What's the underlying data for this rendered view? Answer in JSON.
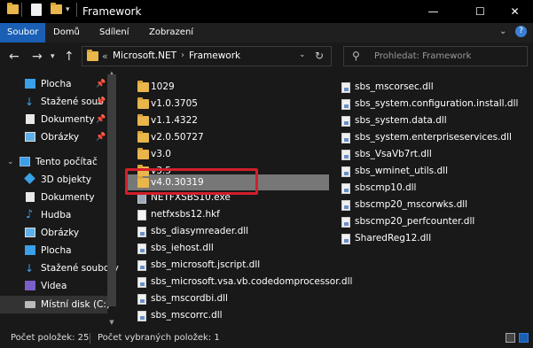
{
  "window": {
    "title": "Framework",
    "controls": {
      "minimize": "—",
      "maximize": "☐",
      "close": "✕"
    }
  },
  "ribbon": {
    "tabs": [
      "Soubor",
      "Domů",
      "Sdílení",
      "Zobrazení"
    ],
    "active_tab_color": "#1a5fb4"
  },
  "nav": {
    "path": [
      "Microsoft.NET",
      "Framework"
    ],
    "overflow": "«",
    "search_placeholder": "Prohledat: Framework"
  },
  "sidebar": {
    "items": [
      {
        "label": "Plocha",
        "icon": "desktop-icon",
        "pinned": true
      },
      {
        "label": "Stažené soub",
        "icon": "download-icon",
        "pinned": true
      },
      {
        "label": "Dokumenty",
        "icon": "documents-icon",
        "pinned": true
      },
      {
        "label": "Obrázky",
        "icon": "pictures-icon",
        "pinned": true
      },
      {
        "label": "Tento počítač",
        "icon": "computer-icon",
        "pinned": false
      },
      {
        "label": "3D objekty",
        "icon": "3d-objects-icon",
        "pinned": false
      },
      {
        "label": "Dokumenty",
        "icon": "documents-icon",
        "pinned": false
      },
      {
        "label": "Hudba",
        "icon": "music-icon",
        "pinned": false
      },
      {
        "label": "Obrázky",
        "icon": "pictures-icon",
        "pinned": false
      },
      {
        "label": "Plocha",
        "icon": "desktop-icon",
        "pinned": false
      },
      {
        "label": "Stažené soubory",
        "icon": "download-icon",
        "pinned": false
      },
      {
        "label": "Videa",
        "icon": "video-icon",
        "pinned": false
      },
      {
        "label": "Místní disk (C:)",
        "icon": "drive-icon",
        "pinned": false
      }
    ]
  },
  "files": {
    "col1": [
      {
        "name": "1029",
        "type": "folder"
      },
      {
        "name": "v1.0.3705",
        "type": "folder"
      },
      {
        "name": "v1.1.4322",
        "type": "folder"
      },
      {
        "name": "v2.0.50727",
        "type": "folder"
      },
      {
        "name": "v3.0",
        "type": "folder"
      },
      {
        "name": "v3.5",
        "type": "folder"
      },
      {
        "name": "v4.0.30319",
        "type": "folder",
        "selected": true
      },
      {
        "name": "NETFXSBS10.exe",
        "type": "exe"
      },
      {
        "name": "netfxsbs12.hkf",
        "type": "file"
      },
      {
        "name": "sbs_diasymreader.dll",
        "type": "dll"
      },
      {
        "name": "sbs_iehost.dll",
        "type": "dll"
      },
      {
        "name": "sbs_microsoft.jscript.dll",
        "type": "dll"
      },
      {
        "name": "sbs_microsoft.vsa.vb.codedomprocessor.dll",
        "type": "dll"
      },
      {
        "name": "sbs_mscordbi.dll",
        "type": "dll"
      },
      {
        "name": "sbs_mscorrc.dll",
        "type": "dll"
      }
    ],
    "col2": [
      {
        "name": "sbs_mscorsec.dll",
        "type": "dll"
      },
      {
        "name": "sbs_system.configuration.install.dll",
        "type": "dll"
      },
      {
        "name": "sbs_system.data.dll",
        "type": "dll"
      },
      {
        "name": "sbs_system.enterpriseservices.dll",
        "type": "dll"
      },
      {
        "name": "sbs_VsaVb7rt.dll",
        "type": "dll"
      },
      {
        "name": "sbs_wminet_utils.dll",
        "type": "dll"
      },
      {
        "name": "sbscmp10.dll",
        "type": "dll"
      },
      {
        "name": "sbscmp20_mscorwks.dll",
        "type": "dll"
      },
      {
        "name": "sbscmp20_perfcounter.dll",
        "type": "dll"
      },
      {
        "name": "SharedReg12.dll",
        "type": "dll"
      }
    ]
  },
  "status": {
    "count": "Počet položek: 25",
    "selected": "Počet vybraných položek: 1"
  }
}
